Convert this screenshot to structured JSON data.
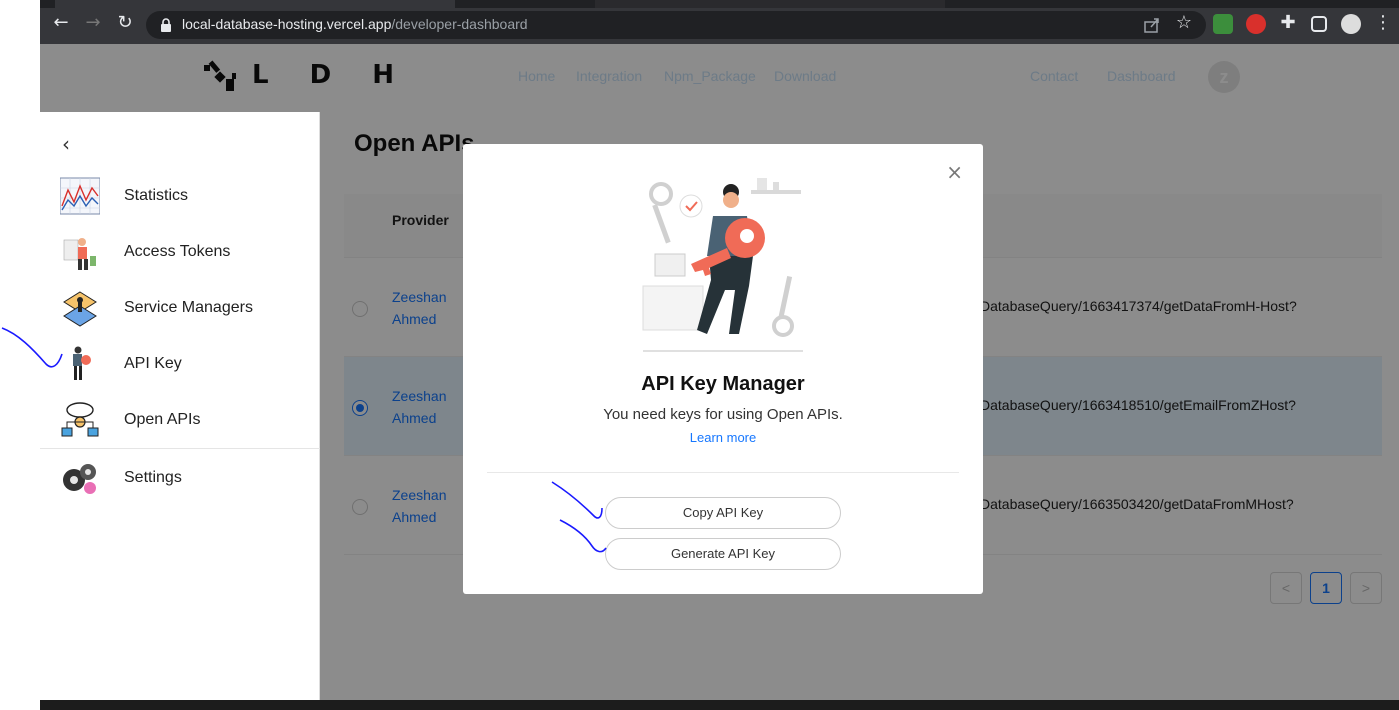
{
  "browser": {
    "url_host": "local-database-hosting.vercel.app",
    "url_path": "/developer-dashboard"
  },
  "header": {
    "logo_text": "L D H",
    "nav": [
      "Home",
      "Integration",
      "Npm_Package",
      "Download",
      "Contact",
      "Dashboard"
    ],
    "avatar_letter": "z"
  },
  "main": {
    "title": "Open APIs",
    "column_provider": "Provider",
    "rows": [
      {
        "provider": "Zeeshan Ahmed",
        "api": "DatabaseQuery/1663417374/getDataFromH-Host?",
        "selected": false
      },
      {
        "provider": "Zeeshan Ahmed",
        "api": "DatabaseQuery/1663418510/getEmailFromZHost?",
        "selected": true
      },
      {
        "provider": "Zeeshan Ahmed",
        "api": "DatabaseQuery/1663503420/getDataFromMHost?",
        "selected": false
      }
    ],
    "pagination": {
      "prev": "<",
      "page": "1",
      "next": ">"
    }
  },
  "sidebar": {
    "back": "‹",
    "items": [
      {
        "label": "Statistics",
        "icon": "statistics-chart-icon"
      },
      {
        "label": "Access Tokens",
        "icon": "access-tokens-icon"
      },
      {
        "label": "Service Managers",
        "icon": "service-managers-icon"
      },
      {
        "label": "API Key",
        "icon": "api-key-icon"
      },
      {
        "label": "Open APIs",
        "icon": "open-apis-network-icon"
      },
      {
        "label": "Settings",
        "icon": "settings-gears-icon"
      }
    ]
  },
  "modal": {
    "close": "×",
    "title": "API Key Manager",
    "subtitle": "You need keys for using Open APIs.",
    "link": "Learn more",
    "copy_button": "Copy API Key",
    "generate_button": "Generate API Key"
  },
  "colors": {
    "accent": "#1677ff",
    "chrome": "#35363a",
    "selected_row": "#e6f4ff",
    "illustration_accent": "#f06b57"
  }
}
